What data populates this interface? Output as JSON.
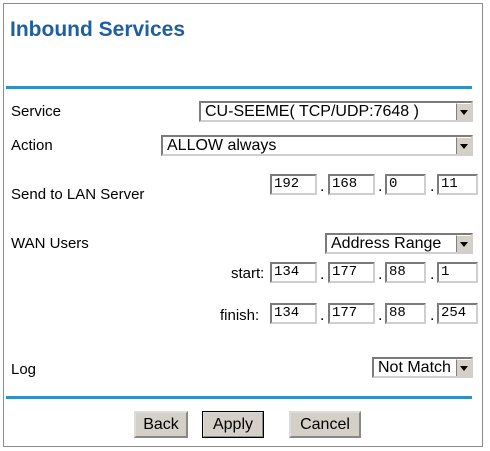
{
  "title": "Inbound Services",
  "service": {
    "label": "Service",
    "value": "CU-SEEME( TCP/UDP:7648 )"
  },
  "action": {
    "label": "Action",
    "value": "ALLOW always"
  },
  "lan_server": {
    "label": "Send to LAN Server",
    "octets": [
      "192",
      "168",
      "0",
      "11"
    ]
  },
  "wan_users": {
    "label": "WAN Users",
    "value": "Address Range",
    "start_label": "start:",
    "start": [
      "134",
      "177",
      "88",
      "1"
    ],
    "finish_label": "finish:",
    "finish": [
      "134",
      "177",
      "88",
      "254"
    ]
  },
  "log": {
    "label": "Log",
    "value": "Not Match"
  },
  "buttons": {
    "back": "Back",
    "apply": "Apply",
    "cancel": "Cancel"
  },
  "separator": "."
}
